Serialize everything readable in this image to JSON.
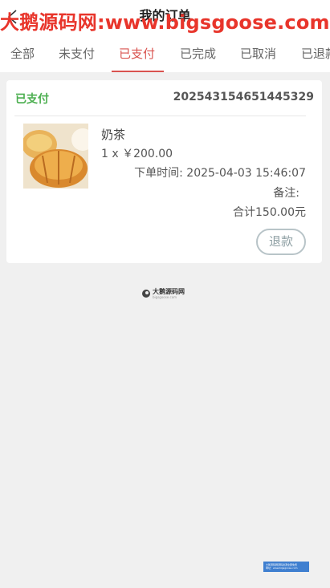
{
  "header": {
    "title": "我的订单",
    "watermark": "大鹅源码网:www.bigsgoose.com"
  },
  "tabs": [
    {
      "label": "全部"
    },
    {
      "label": "未支付"
    },
    {
      "label": "已支付",
      "active": true
    },
    {
      "label": "已完成"
    },
    {
      "label": "已取消"
    },
    {
      "label": "已退款"
    }
  ],
  "order": {
    "status": "已支付",
    "order_number": "202543154651445329",
    "product_name": "奶茶",
    "quantity_price": "1 x ￥200.00",
    "order_time_label": "下单时间:",
    "order_time": "2025-04-03 15:46:07",
    "remark_label": "备注:",
    "total": "合计150.00元",
    "refund_label": "退款"
  },
  "footer": {
    "logo_text": "大鹅源码网",
    "logo_sub": "bigsgoose.com",
    "badge_line1": "大鹅源码网源码资源全部免费",
    "badge_line2": "网址：www.bigsgoose.com"
  },
  "colors": {
    "accent": "#d9534f",
    "status_paid": "#4caf50",
    "watermark": "#e8352b"
  }
}
